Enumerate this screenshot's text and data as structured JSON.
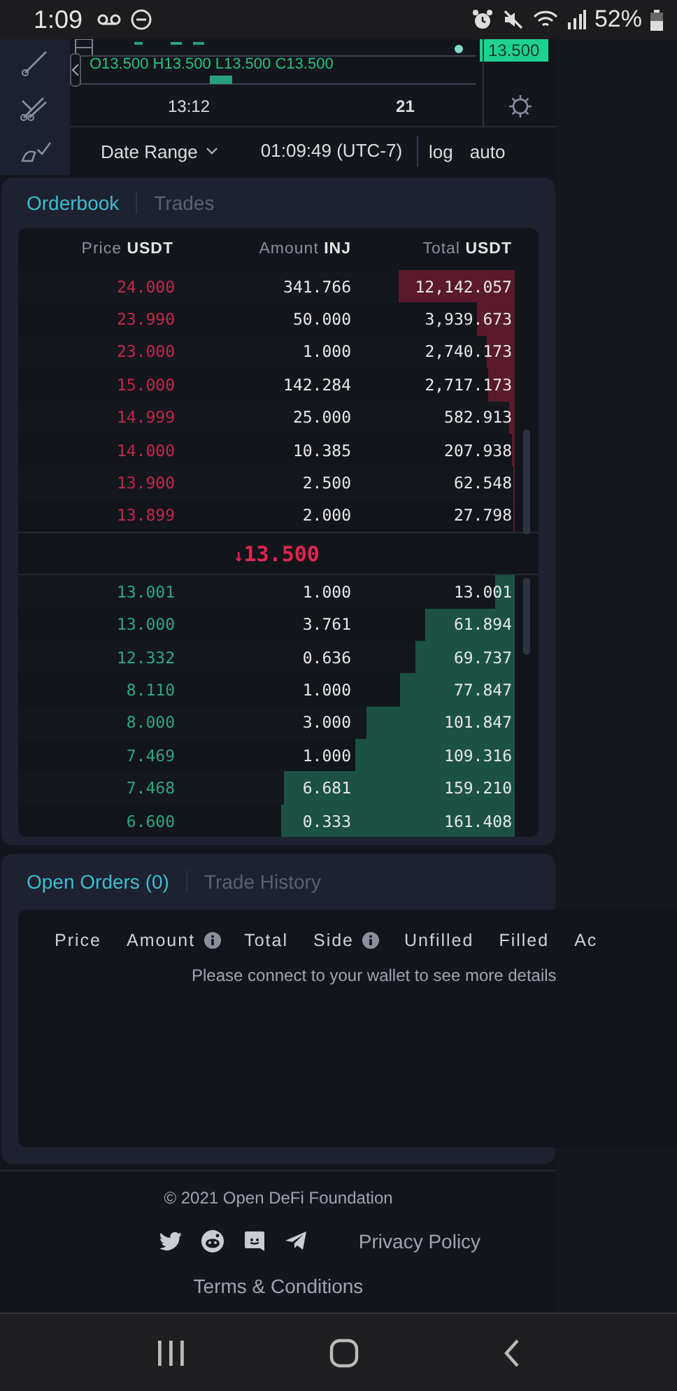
{
  "status_bar": {
    "time": "1:09",
    "battery": "52%"
  },
  "chart": {
    "legend": "O13.500 H13.500 L13.500 C13.500",
    "price_label": "13.500",
    "time_labels": [
      "13:12",
      "21"
    ],
    "date_range": "Date Range",
    "clock": "01:09:49 (UTC-7)",
    "scale_options": [
      "log",
      "auto"
    ]
  },
  "orderbook": {
    "tabs": [
      {
        "label": "Orderbook",
        "selected": true
      },
      {
        "label": "Trades",
        "selected": false
      }
    ],
    "columns": [
      {
        "label": "Price",
        "unit": "USDT"
      },
      {
        "label": "Amount",
        "unit": "INJ"
      },
      {
        "label": "Total",
        "unit": "USDT"
      }
    ],
    "asks": [
      {
        "price": "24.000",
        "amount": "341.766",
        "total": "12,142.057",
        "level": 0.235
      },
      {
        "price": "23.990",
        "amount": "50.000",
        "total": "3,939.673",
        "level": 0.075
      },
      {
        "price": "23.000",
        "amount": "1.000",
        "total": "2,740.173",
        "level": 0.056
      },
      {
        "price": "15.000",
        "amount": "142.284",
        "total": "2,717.173",
        "level": 0.053
      },
      {
        "price": "14.999",
        "amount": "25.000",
        "total": "582.913",
        "level": 0.012
      },
      {
        "price": "14.000",
        "amount": "10.385",
        "total": "207.938",
        "level": 0.006
      },
      {
        "price": "13.900",
        "amount": "2.500",
        "total": "62.548",
        "level": 0.003
      },
      {
        "price": "13.899",
        "amount": "2.000",
        "total": "27.798",
        "level": 0.002
      }
    ],
    "last_price": {
      "arrow": "↓",
      "value": "13.500"
    },
    "bids": [
      {
        "price": "13.001",
        "amount": "1.000",
        "total": "13.001",
        "level": 0.04
      },
      {
        "price": "13.000",
        "amount": "3.761",
        "total": "61.894",
        "level": 0.18
      },
      {
        "price": "12.332",
        "amount": "0.636",
        "total": "69.737",
        "level": 0.2
      },
      {
        "price": "8.110",
        "amount": "1.000",
        "total": "77.847",
        "level": 0.23
      },
      {
        "price": "8.000",
        "amount": "3.000",
        "total": "101.847",
        "level": 0.3
      },
      {
        "price": "7.469",
        "amount": "1.000",
        "total": "109.316",
        "level": 0.32
      },
      {
        "price": "7.468",
        "amount": "6.681",
        "total": "159.210",
        "level": 0.465
      },
      {
        "price": "6.600",
        "amount": "0.333",
        "total": "161.408",
        "level": 0.47
      }
    ]
  },
  "open_orders": {
    "tabs": [
      {
        "label": "Open Orders (0)",
        "selected": true
      },
      {
        "label": "Trade History",
        "selected": false
      }
    ],
    "columns": [
      {
        "label": "Price",
        "info": false
      },
      {
        "label": "Amount",
        "info": true
      },
      {
        "label": "Total",
        "info": false
      },
      {
        "label": "Side",
        "info": true
      },
      {
        "label": "Unfilled",
        "info": false
      },
      {
        "label": "Filled",
        "info": false
      },
      {
        "label": "Ac",
        "info": false
      }
    ],
    "empty_message": "Please connect to your wallet to see more details"
  },
  "footer": {
    "copyright": "© 2021 Open DeFi Foundation",
    "privacy_link": "Privacy Policy",
    "terms_link": "Terms & Conditions"
  }
}
